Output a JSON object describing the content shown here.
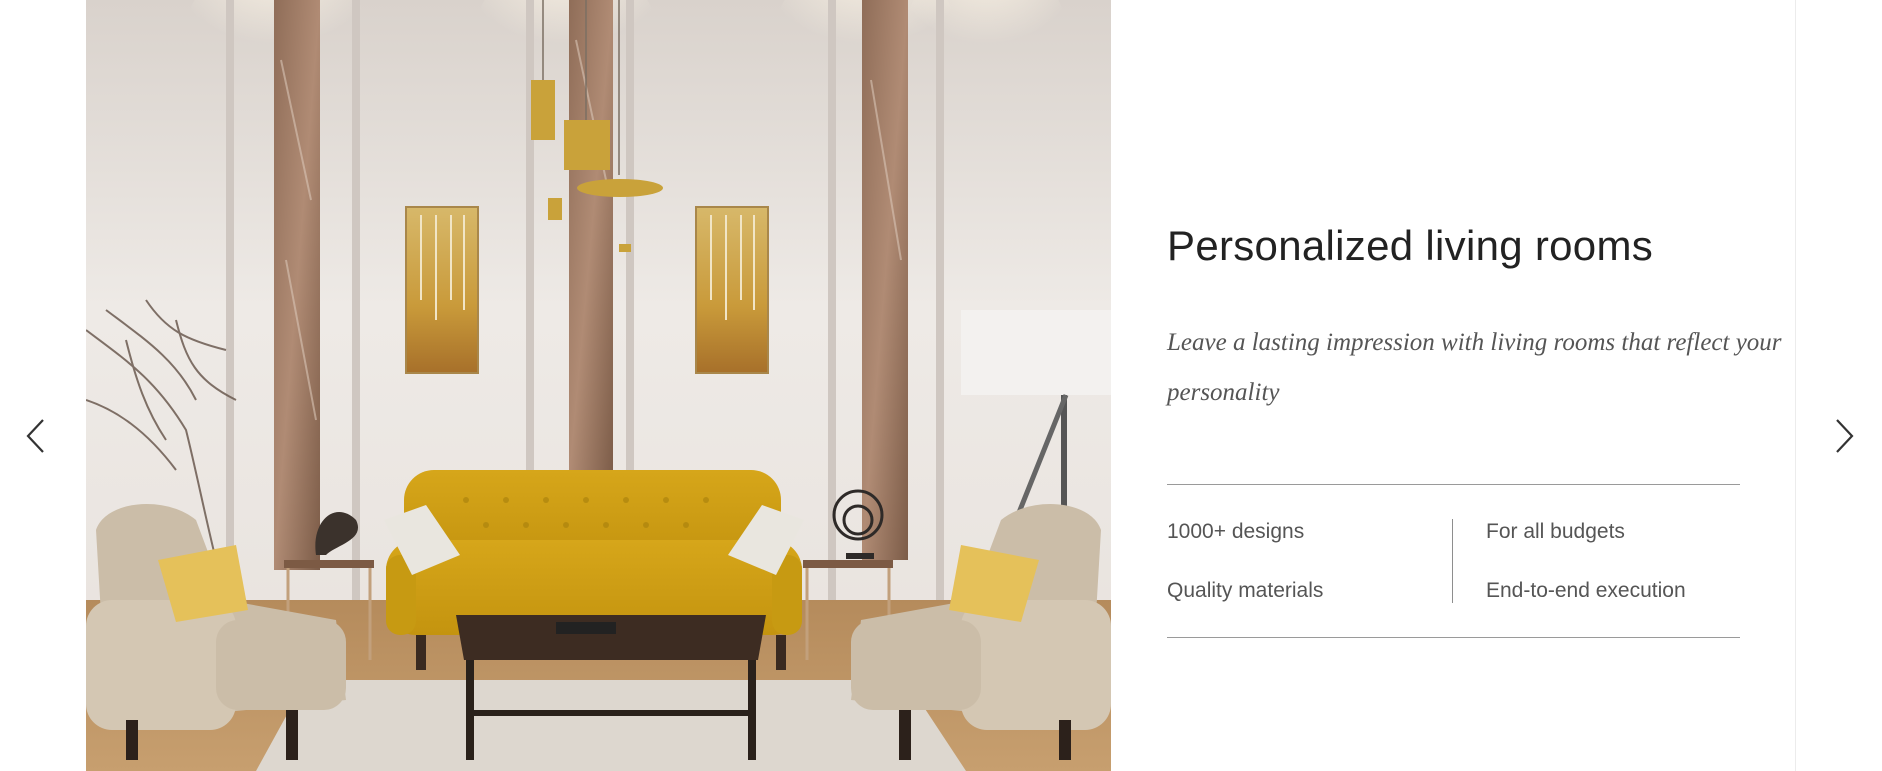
{
  "slider": {
    "prev_icon": "chevron-left-icon",
    "next_icon": "chevron-right-icon"
  },
  "hero_image": {
    "subject": "living-room-photo"
  },
  "card": {
    "title": "Personalized living rooms",
    "subtitle": "Leave a lasting impression with living rooms that reflect your personality",
    "features": [
      "1000+ designs",
      "Quality materials",
      "For all budgets",
      "End-to-end execution"
    ]
  },
  "colors": {
    "title": "#222222",
    "text": "#555555",
    "rule": "#9a9a9a",
    "sofa": "#d9a91a"
  }
}
